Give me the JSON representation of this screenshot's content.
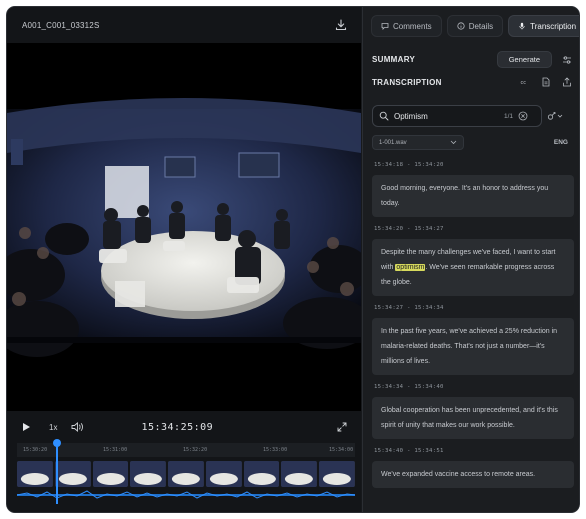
{
  "clip": {
    "name": "A001_C001_03312S"
  },
  "player": {
    "play_icon": "play-icon",
    "speed": "1x",
    "timecode": "15:34:25:09"
  },
  "timeline": {
    "ruler_labels": [
      "15:30:20",
      "15:31:00",
      "15:32:20",
      "15:33:00",
      "15:34:00"
    ]
  },
  "panel": {
    "tabs": [
      {
        "label": "Comments",
        "icon": "comment-icon"
      },
      {
        "label": "Details",
        "icon": "info-icon"
      },
      {
        "label": "Transcription",
        "icon": "mic-icon"
      }
    ],
    "summary_title": "SUMMARY",
    "generate_label": "Generate",
    "transcription_title": "TRANSCRIPTION",
    "search": {
      "value": "Optimism",
      "match_count": "1/1"
    },
    "file": "1-001.wav",
    "language": "ENG"
  },
  "segments": [
    {
      "time": "15:34:18 - 15:34:20",
      "text": "Good morning, everyone. It's an honor to address you today."
    },
    {
      "time": "15:34:20 - 15:34:27",
      "pre": "Despite the many challenges we've faced, I want to start with ",
      "highlight": "optimism",
      "post": ". We've seen remarkable progress across the globe."
    },
    {
      "time": "15:34:27 - 15:34:34",
      "text": "In the past five years, we've achieved a 25% reduction in malaria-related deaths. That's not just a number—it's millions of lives."
    },
    {
      "time": "15:34:34 - 15:34:40",
      "text": "Global cooperation has been unprecedented, and it's this spirit of unity that makes our work possible."
    },
    {
      "time": "15:34:40 - 15:34:51",
      "text": "We've expanded vaccine access to remote areas."
    }
  ],
  "colors": {
    "accent": "#2f8fff",
    "highlight": "#d6d95d",
    "panel": "#1b1d20"
  }
}
